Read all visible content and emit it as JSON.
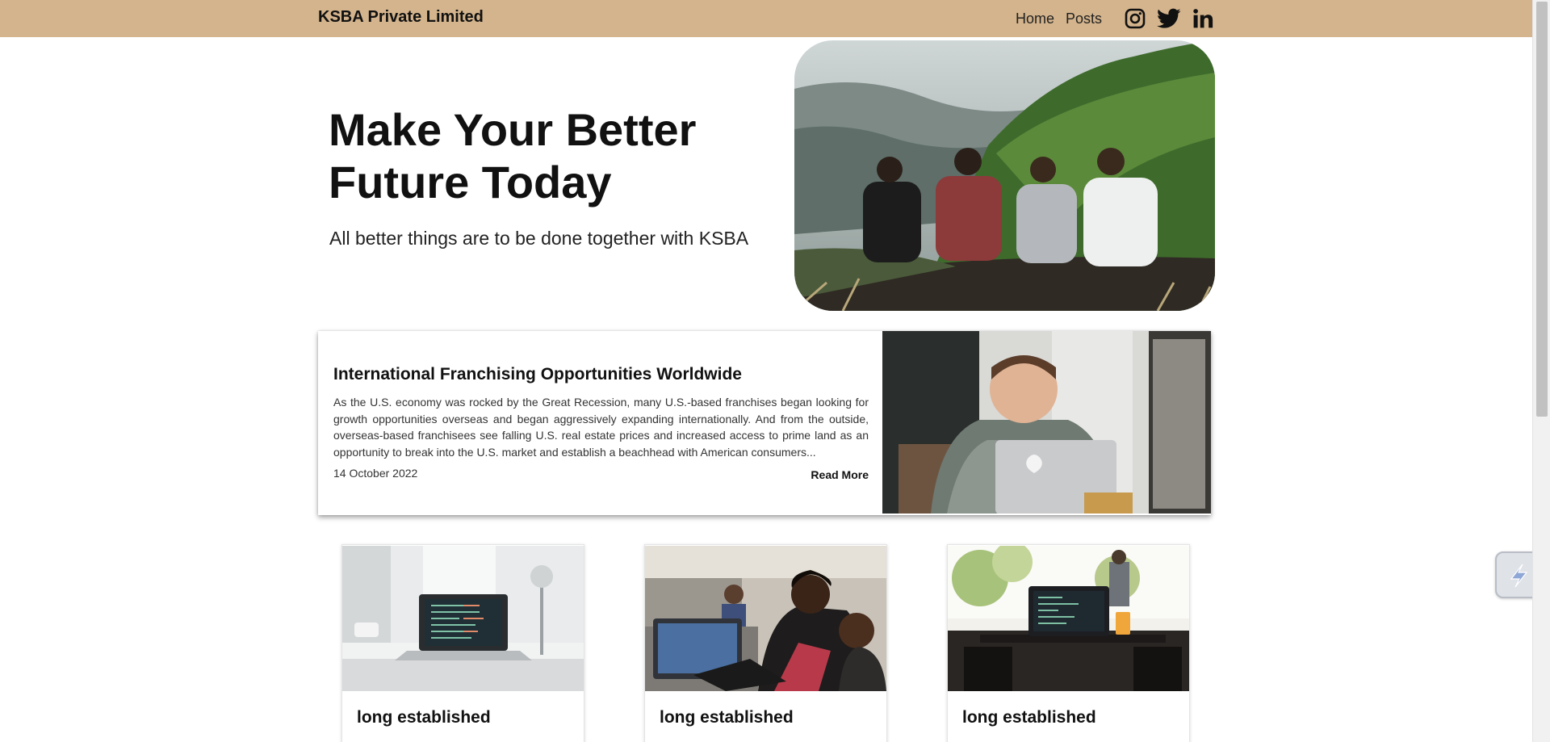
{
  "navbar": {
    "brand": "KSBA Private Limited",
    "links": [
      "Home",
      "Posts"
    ],
    "icons": [
      "instagram-icon",
      "twitter-icon",
      "linkedin-icon"
    ],
    "background": "#d4b48c"
  },
  "hero": {
    "title": "Make Your Better Future Today",
    "subtitle": "All better things are to be done together with KSBA"
  },
  "featured_post": {
    "title": "International Franchising Opportunities Worldwide",
    "excerpt": "As the U.S. economy was rocked by the Great Recession, many U.S.-based franchises began looking for growth opportunities overseas and began aggressively expanding internationally. And from the outside, overseas-based franchisees see falling U.S. real estate prices and increased access to prime land as an opportunity to break into the U.S. market and establish a beachhead with American consumers...",
    "date": "14 October 2022",
    "read_more": "Read More"
  },
  "cards": [
    {
      "title": "long established"
    },
    {
      "title": "long established"
    },
    {
      "title": "long established"
    }
  ]
}
